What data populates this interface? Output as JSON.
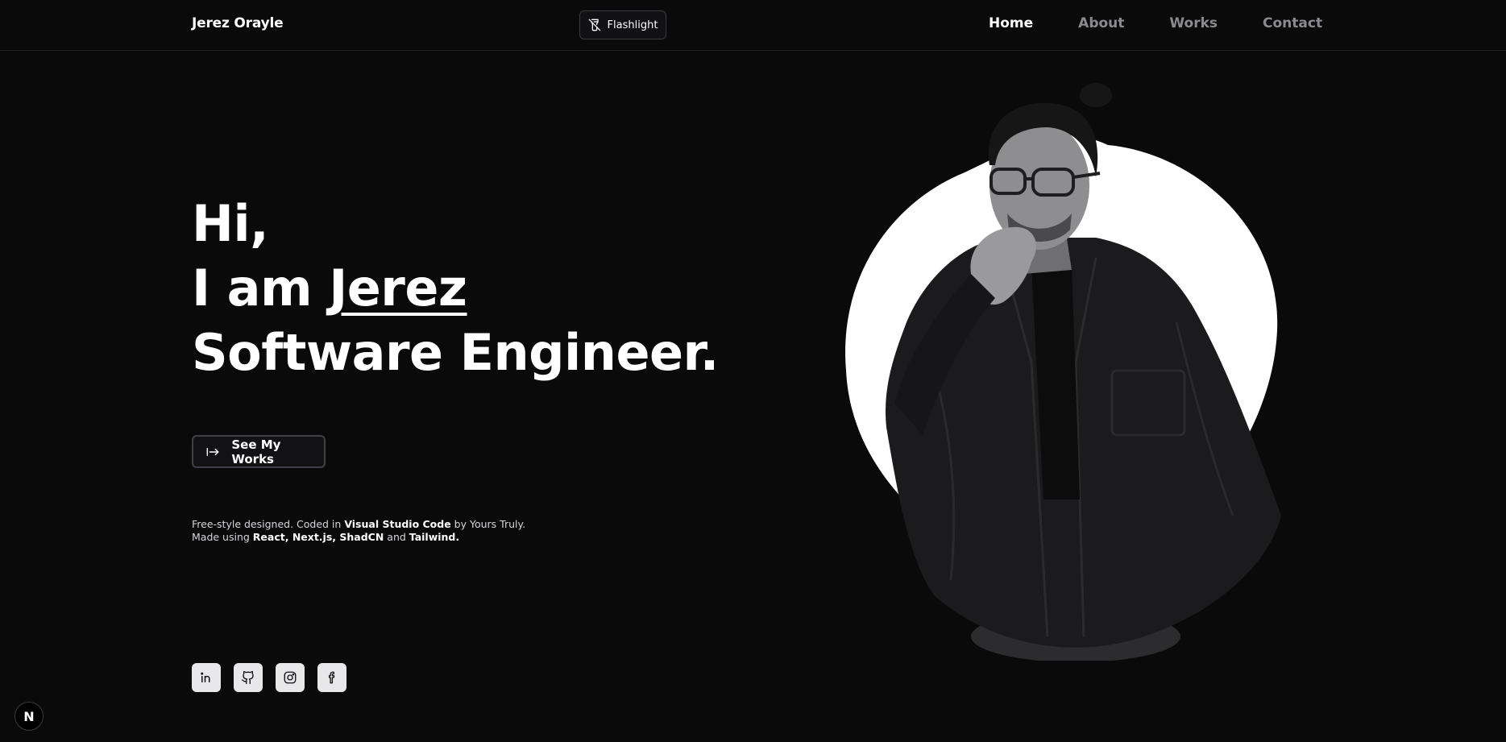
{
  "header": {
    "brand": "Jerez Orayle",
    "flashlight_label": "Flashlight",
    "nav": [
      {
        "label": "Home",
        "active": true
      },
      {
        "label": "About",
        "active": false
      },
      {
        "label": "Works",
        "active": false
      },
      {
        "label": "Contact",
        "active": false
      }
    ]
  },
  "hero": {
    "line1": "Hi,",
    "line2_prefix": "I am ",
    "line2_name": "Jerez",
    "line3": "Software Engineer."
  },
  "cta": {
    "label": "See My Works",
    "icon": "arrow-right-to-line-icon"
  },
  "credits": {
    "l1_a": "Free-style designed. Coded in ",
    "l1_b": "Visual Studio Code",
    "l1_c": " by Yours Truly.",
    "l2_a": "Made using ",
    "l2_b": "React",
    "l2_c": ", ",
    "l2_d": "Next.js",
    "l2_e": ", ",
    "l2_f": "ShadCN",
    "l2_g": " and ",
    "l2_h": "Tailwind."
  },
  "socials": [
    {
      "icon": "linkedin-icon"
    },
    {
      "icon": "github-icon"
    },
    {
      "icon": "instagram-icon"
    },
    {
      "icon": "facebook-icon"
    }
  ],
  "next_badge": "N",
  "colors": {
    "background": "#0a0a0b",
    "text": "#ffffff",
    "muted_nav": "#8a8a90",
    "social_bg": "#e8e8ea"
  }
}
